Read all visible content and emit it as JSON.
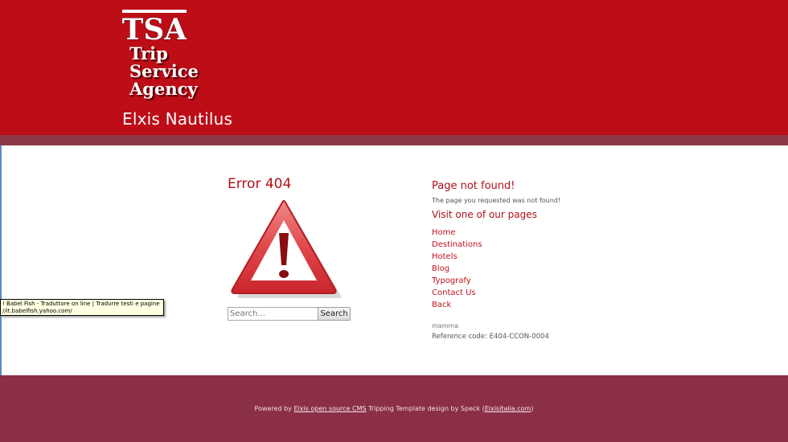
{
  "header": {
    "logo_abbrev": "TSA",
    "logo_lines": [
      "Trip",
      "Service",
      "Agency"
    ],
    "site_name": "Elxis Nautilus"
  },
  "main": {
    "error_title": "Error 404",
    "search": {
      "placeholder": "Search...",
      "button_label": "Search"
    },
    "tooltip": {
      "line1": "! Babel Fish - Traduttore on line | Tradurre testi e pagine web",
      "line2": "//it.babelfish.yahoo.com/"
    },
    "page_not_found": {
      "title": "Page not found!",
      "message": "The page you requested was not found!",
      "visit_title": "Visit one of our pages",
      "links": [
        {
          "label": "Home"
        },
        {
          "label": "Destinations"
        },
        {
          "label": "Hotels"
        },
        {
          "label": "Blog"
        },
        {
          "label": "Typografy"
        },
        {
          "label": "Contact Us"
        },
        {
          "label": "Back"
        }
      ],
      "note": "mamma",
      "reference_code": "Reference code: E404-CCON-0004"
    }
  },
  "footer": {
    "prefix": "Powered by ",
    "cms_link": "Elxis open source CMS",
    "middle": " Tripping Template design by Speck (",
    "site_link": "Elxisitalia.com",
    "suffix": ")"
  },
  "colors": {
    "header_red": "#bd0d17",
    "band": "#8c3a4a",
    "footer": "#8a2f46",
    "link_red": "#c0121c"
  },
  "icons": {
    "warning": "warning-triangle-icon"
  }
}
